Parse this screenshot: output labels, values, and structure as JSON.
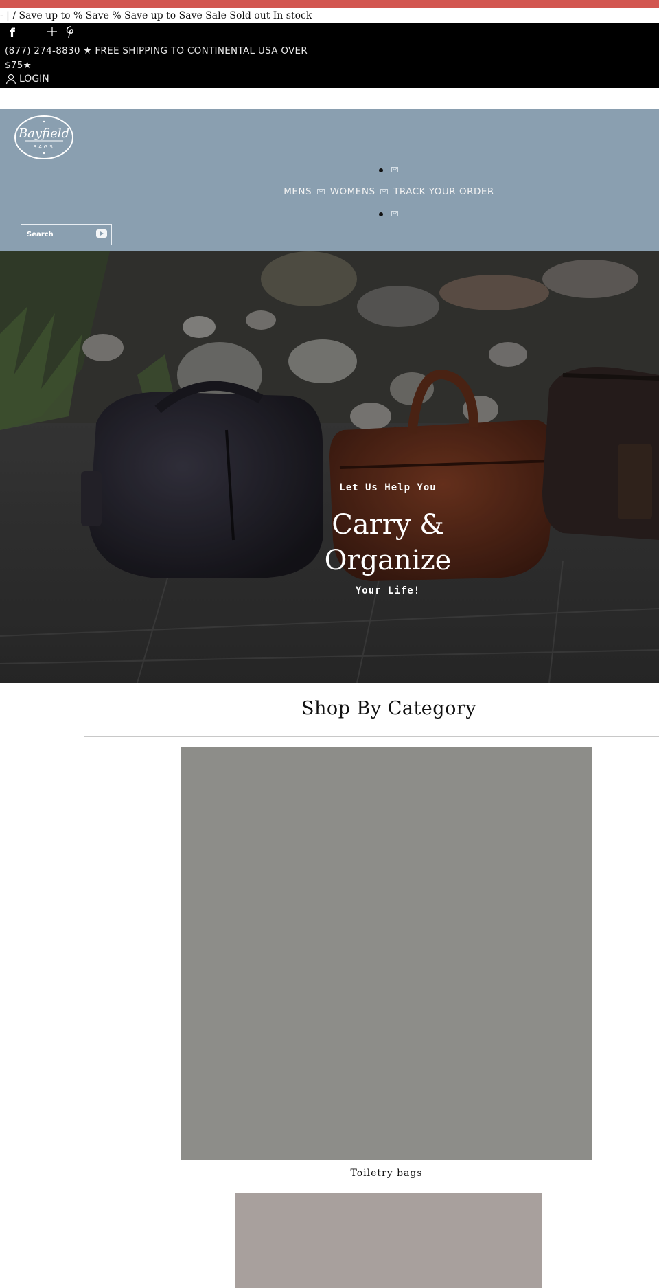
{
  "announcement": {
    "text": "- | / Save up to % Save % Save up to Save Sale Sold out In stock"
  },
  "topbar": {
    "social": [
      {
        "icon": "facebook-icon",
        "glyph": "f"
      },
      {
        "icon": "plus-icon",
        "glyph": ""
      },
      {
        "icon": "pinterest-icon",
        "glyph": ""
      }
    ],
    "contact_line": "(877) 274-8830 ★ FREE SHIPPING TO CONTINENTAL USA OVER $75★",
    "login_label": "LOGIN"
  },
  "header": {
    "logo": {
      "brand": "Bayfield",
      "sub": "BAGS"
    },
    "nav": {
      "items": [
        "MENS",
        "WOMENS",
        "TRACK YOUR ORDER"
      ],
      "separator_icon": "envelope-icon"
    },
    "search": {
      "placeholder": "Search",
      "button_icon": "play-icon"
    }
  },
  "hero": {
    "kicker": "Let Us Help You",
    "title": "Carry & Organize",
    "subtitle": "Your Life!"
  },
  "categories": {
    "title": "Shop By Category",
    "items": [
      {
        "label": "Toiletry bags",
        "color": "#8d8d89"
      },
      {
        "label": "",
        "color": "#a8a09d"
      }
    ]
  },
  "colors": {
    "accent_strip": "#d25650",
    "topbar_bg": "#000000",
    "header_bg": "#8a9fb0"
  }
}
